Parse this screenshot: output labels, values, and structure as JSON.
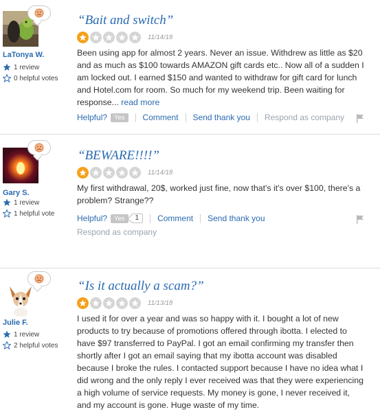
{
  "reviews": [
    {
      "user": {
        "name": "LaTonya W.",
        "reviews": "1 review",
        "votes": "0 helpful votes"
      },
      "title": "“Bait and switch”",
      "rating": 1,
      "date": "11/14/18",
      "text": "Been using app for almost 2 years. Never an issue. Withdrew as little as $20 and as much as $100 towards AMAZON gift cards etc.. Now all of a sudden I am locked out. I earned $150 and wanted to withdraw for gift card for lunch and Hotel.com for room. So much for my weekend trip. Been waiting for response...",
      "read_more": "read more",
      "actions": {
        "helpful": "Helpful?",
        "yes": "Yes",
        "comment": "Comment",
        "thanks": "Send thank you",
        "respond": "Respond as company"
      }
    },
    {
      "user": {
        "name": "Gary S.",
        "reviews": "1 review",
        "votes": "1 helpful vote"
      },
      "title": "“BEWARE!!!!”",
      "rating": 1,
      "date": "11/14/18",
      "text": "My first withdrawal, 20$, worked just fine, now that's it's over $100, there's a problem? Strange??",
      "actions": {
        "helpful": "Helpful?",
        "yes": "Yes",
        "count": "1",
        "comment": "Comment",
        "thanks": "Send thank you",
        "respond": "Respond as company"
      }
    },
    {
      "user": {
        "name": "Julie F.",
        "reviews": "1 review",
        "votes": "2 helpful votes"
      },
      "title": "“Is it actually a scam?”",
      "rating": 1,
      "date": "11/13/18",
      "text": "I used it for over a year and was so happy with it. I bought a lot of new products to try because of promotions offered through ibotta. I elected to have $97 transferred to PayPal. I got an email confirming my transfer then shortly after I got an email saying that my ibotta account was disabled because I broke the rules. I contacted support because I have no idea what I did wrong and the only reply I ever received was that they were experiencing a high volume of service requests. My money is gone, I never received it, and my account is gone. Huge waste of my time."
    }
  ],
  "icons": {
    "sentiment": "sad-face-icon",
    "review_count": "star-icon",
    "helpful": "star-outline-icon",
    "report": "flag-icon",
    "rating": "star-icon"
  },
  "colors": {
    "link": "#2a6ab1",
    "star_on": "#f5a11a",
    "star_off": "#d5d5d5",
    "muted": "#9aa3ad"
  }
}
